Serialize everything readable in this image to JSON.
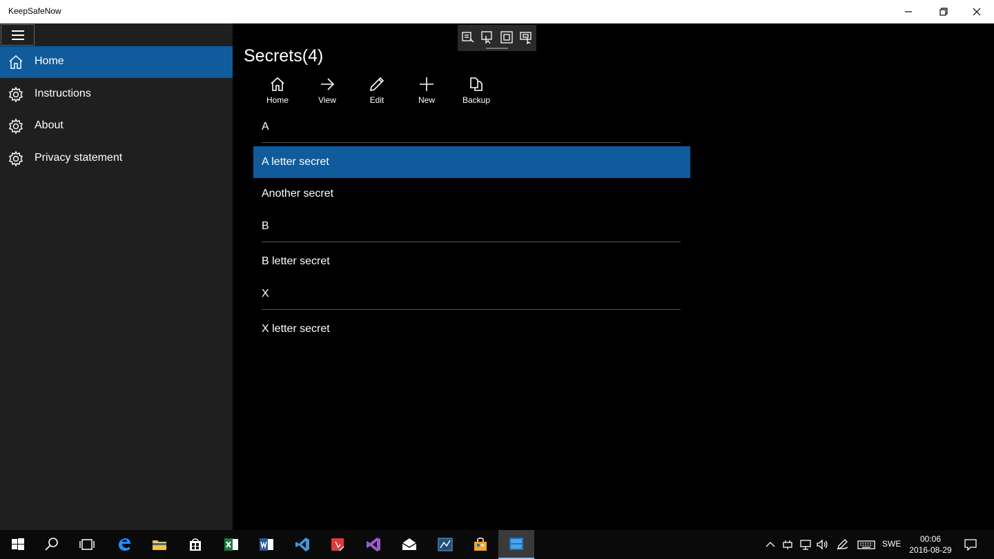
{
  "window": {
    "title": "KeepSafeNow"
  },
  "sidebar": {
    "items": [
      {
        "label": "Home",
        "icon": "home-icon",
        "active": true
      },
      {
        "label": "Instructions",
        "icon": "gear-icon"
      },
      {
        "label": "About",
        "icon": "gear-icon"
      },
      {
        "label": "Privacy statement",
        "icon": "gear-icon"
      }
    ]
  },
  "main": {
    "title": "Secrets(4)",
    "commands": [
      {
        "label": "Home",
        "icon": "home-icon"
      },
      {
        "label": "View",
        "icon": "arrow-right-icon"
      },
      {
        "label": "Edit",
        "icon": "pencil-icon"
      },
      {
        "label": "New",
        "icon": "plus-icon"
      },
      {
        "label": "Backup",
        "icon": "copy-icon"
      }
    ],
    "groups": [
      {
        "letter": "A",
        "items": [
          "A letter secret",
          "Another secret"
        ],
        "selected": "A letter secret"
      },
      {
        "letter": "B",
        "items": [
          "B letter secret"
        ]
      },
      {
        "letter": "X",
        "items": [
          "X letter secret"
        ]
      }
    ]
  },
  "taskbar": {
    "apps": [
      "start-icon",
      "search-icon",
      "task-view-icon",
      "edge-icon",
      "file-explorer-icon",
      "store-icon",
      "excel-icon",
      "word-icon",
      "vscode-icon",
      "acrobat-icon",
      "visual-studio-icon",
      "mail-icon",
      "app-icon",
      "store-bag-icon",
      "keepsafenow-icon"
    ],
    "language": "SWE",
    "time": "00:06",
    "date": "2016-08-29"
  },
  "colors": {
    "accent": "#0f5b9c",
    "sidebar_bg": "#1f1f1f",
    "background": "#000000"
  }
}
